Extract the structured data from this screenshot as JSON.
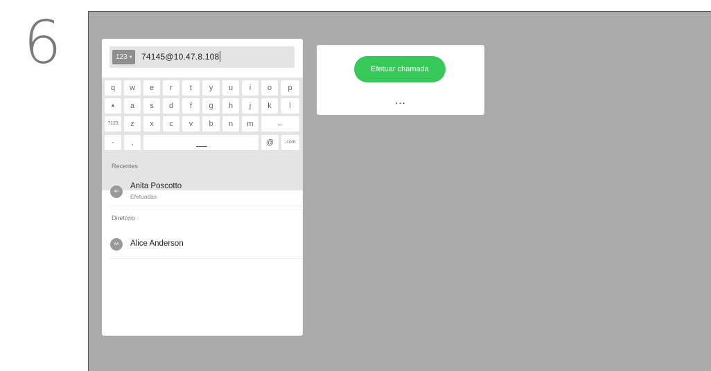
{
  "step": {
    "number": "6"
  },
  "dial": {
    "mode_label": "123",
    "input_value": "74145@10.47.8.108"
  },
  "keyboard": {
    "row1": [
      "q",
      "w",
      "e",
      "r",
      "t",
      "y",
      "u",
      "i",
      "o",
      "p"
    ],
    "row2": [
      "a",
      "s",
      "d",
      "f",
      "g",
      "h",
      "j",
      "k",
      "l"
    ],
    "row3": [
      "z",
      "x",
      "c",
      "v",
      "b",
      "n",
      "m"
    ],
    "shift_glyph": "▲",
    "symbols_label": "?123",
    "backspace_glyph": "←",
    "dash_key": "-",
    "comma_key": ",",
    "at_key": "@",
    "dotcom_key": ".com"
  },
  "recents": {
    "section_label": "Recentes",
    "items": [
      {
        "initials": "AP",
        "name": "Anita Poscotto",
        "sub": "Efetuadas"
      }
    ]
  },
  "directory": {
    "section_label": "Diretório",
    "items": [
      {
        "initials": "AA",
        "name": "Alice Anderson"
      }
    ]
  },
  "call": {
    "call_label": "Efetuar chamada",
    "more_label": "..."
  },
  "colors": {
    "accent_green": "#37c85a",
    "stage_gray": "#aaaaaa",
    "keyboard_bg": "#e4e4e4"
  }
}
